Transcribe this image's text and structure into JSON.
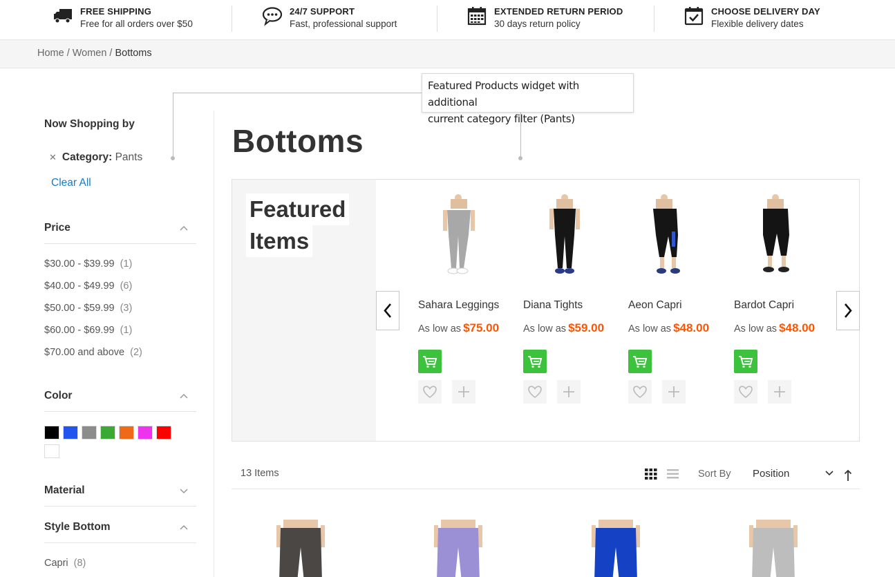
{
  "features": [
    {
      "title": "FREE SHIPPING",
      "sub": "Free for all orders over $50",
      "icon": "truck-icon"
    },
    {
      "title": "24/7 SUPPORT",
      "sub": "Fast, professional support",
      "icon": "chat-icon"
    },
    {
      "title": "EXTENDED RETURN PERIOD",
      "sub": "30 days return policy",
      "icon": "calendar-icon"
    },
    {
      "title": "CHOOSE DELIVERY DAY",
      "sub": "Flexible delivery dates",
      "icon": "calendar-check-icon"
    }
  ],
  "breadcrumb": [
    "Home",
    "Women",
    "Bottoms"
  ],
  "annotation": {
    "line1": "Featured Products widget with additional",
    "line2": "current category filter (Pants)"
  },
  "sidebar": {
    "now_shopping": "Now Shopping by",
    "active_filter": {
      "label": "Category:",
      "value": "Pants"
    },
    "clear_all": "Clear All",
    "price": {
      "title": "Price",
      "rows": [
        {
          "range": "$30.00 - $39.99",
          "count": "(1)"
        },
        {
          "range": "$40.00 - $49.99",
          "count": "(6)"
        },
        {
          "range": "$50.00 - $59.99",
          "count": "(3)"
        },
        {
          "range": "$60.00 - $69.99",
          "count": "(1)"
        },
        {
          "range": "$70.00 and above",
          "count": "(2)"
        }
      ]
    },
    "color": {
      "title": "Color",
      "swatches": [
        "#000000",
        "#2255ee",
        "#8c8c8c",
        "#3aaa35",
        "#ee6a18",
        "#ee33ee",
        "#ff0000",
        "#ffffff"
      ]
    },
    "material": {
      "title": "Material"
    },
    "style_bottom": {
      "title": "Style Bottom",
      "rows": [
        {
          "label": "Capri",
          "count": "(8)"
        }
      ]
    }
  },
  "main": {
    "title": "Bottoms",
    "featured": {
      "heading_line1": "Featured",
      "heading_line2": "Items",
      "products": [
        {
          "name": "Sahara Leggings",
          "prefix": "As low as",
          "price": "$75.00",
          "pants": "#a8a8a8",
          "shoes": "#ffffff"
        },
        {
          "name": "Diana Tights",
          "prefix": "As low as",
          "price": "$59.00",
          "pants": "#161616",
          "shoes": "#2a3a8a"
        },
        {
          "name": "Aeon Capri",
          "prefix": "As low as",
          "price": "$48.00",
          "pants": "#151515",
          "shoes": "#2a3a7a"
        },
        {
          "name": "Bardot Capri",
          "prefix": "As low as",
          "price": "$48.00",
          "pants": "#141414",
          "shoes": "#222222"
        }
      ]
    },
    "toolbar": {
      "count": "13 Items",
      "sort_label": "Sort By",
      "sort_value": "Position"
    },
    "grid_products": [
      {
        "color": "#4a4744"
      },
      {
        "color": "#9b8fd6"
      },
      {
        "color": "#1542c4"
      },
      {
        "color": "#bdbdbd"
      }
    ]
  },
  "colors": {
    "accent_link": "#1979c3",
    "price": "#ff5501",
    "cart": "#3cc23c"
  }
}
